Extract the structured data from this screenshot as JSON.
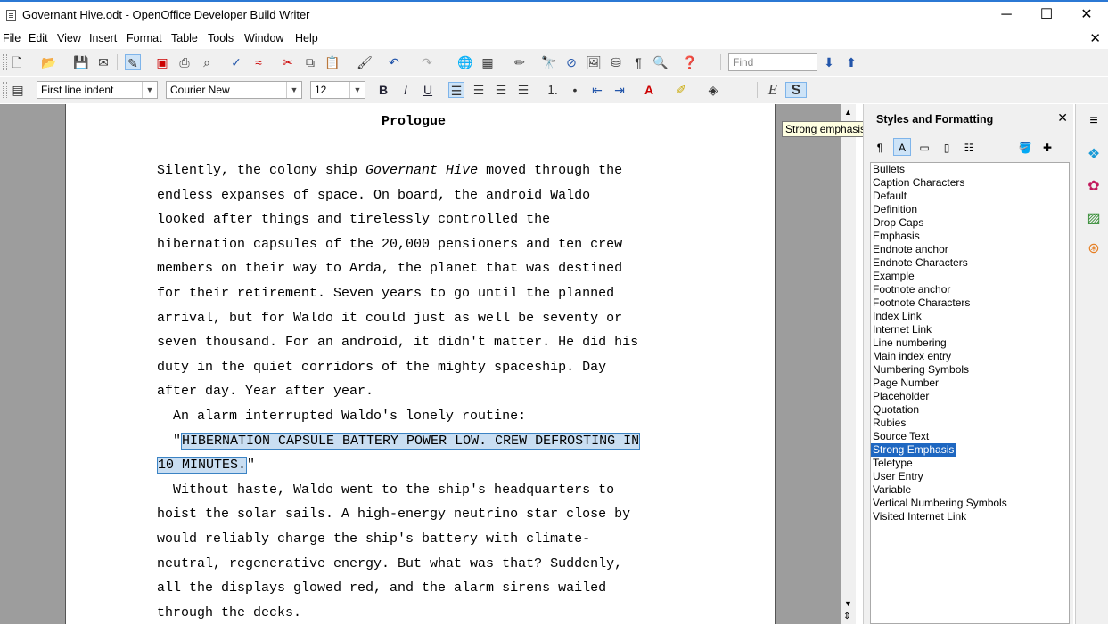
{
  "window": {
    "title": "Governant Hive.odt - OpenOffice Developer Build Writer",
    "minimize": "─",
    "maximize": "☐",
    "close": "✕"
  },
  "menu": {
    "items": [
      "File",
      "Edit",
      "View",
      "Insert",
      "Format",
      "Table",
      "Tools",
      "Window",
      "Help"
    ],
    "close_doc": "✕"
  },
  "toolbar": {
    "find_placeholder": "Find",
    "paragraph_style": "First line indent",
    "font_name": "Courier New",
    "font_size": "12",
    "bold": "B",
    "italic": "I",
    "underline": "U",
    "emphasis": "E",
    "strong": "S"
  },
  "document": {
    "heading": "Prologue",
    "paragraph1": [
      "Silently, the colony ship ",
      "endless expanses of space. On board, the android Waldo",
      "looked after things and tirelessly controlled the",
      "hibernation capsules of the 20,000 pensioners and ten crew",
      "members on their way to Arda, the planet that was destined",
      "for their retirement. Seven years to go until the planned",
      "arrival, but for Waldo it could just as well be seventy or",
      "seven thousand. For an android, it didn't matter. He did his",
      "duty in the quiet corridors of the mighty spaceship. Day",
      "after day. Year after year."
    ],
    "ship_name": "Governant Hive",
    "line1_end": " moved through the",
    "alarm_line": "  An alarm interrupted Waldo's lonely routine:",
    "quote_open": "  \"",
    "quote_sel1": "HIBERNATION CAPSULE BATTERY POWER LOW. CREW DEFROSTING IN",
    "quote_sel2": "10 MINUTES.",
    "quote_close": "\"",
    "paragraph3": [
      "  Without haste, Waldo went to the ship's headquarters to",
      "hoist the solar sails. A high-energy neutrino star close by",
      "would reliably charge the ship's battery with climate-",
      "neutral, regenerative energy. But what was that? Suddenly,",
      "all the displays glowed red, and the alarm sirens wailed",
      "through the decks."
    ]
  },
  "tooltip": "Strong emphasis",
  "styles_panel": {
    "title": "Styles and Formatting",
    "close": "✕",
    "items": [
      "Bullets",
      "Caption Characters",
      "Default",
      "Definition",
      "Drop Caps",
      "Emphasis",
      "Endnote anchor",
      "Endnote Characters",
      "Example",
      "Footnote anchor",
      "Footnote Characters",
      "Index Link",
      "Internet Link",
      "Line numbering",
      "Main index entry",
      "Numbering Symbols",
      "Page Number",
      "Placeholder",
      "Quotation",
      "Rubies",
      "Source Text",
      "Strong Emphasis",
      "Teletype",
      "User Entry",
      "Variable",
      "Vertical Numbering Symbols",
      "Visited Internet Link"
    ],
    "selected": "Strong Emphasis"
  },
  "colors": {
    "accent": "#2b78d4",
    "selection": "#1e67c1",
    "text_selection": "#c9def2"
  }
}
